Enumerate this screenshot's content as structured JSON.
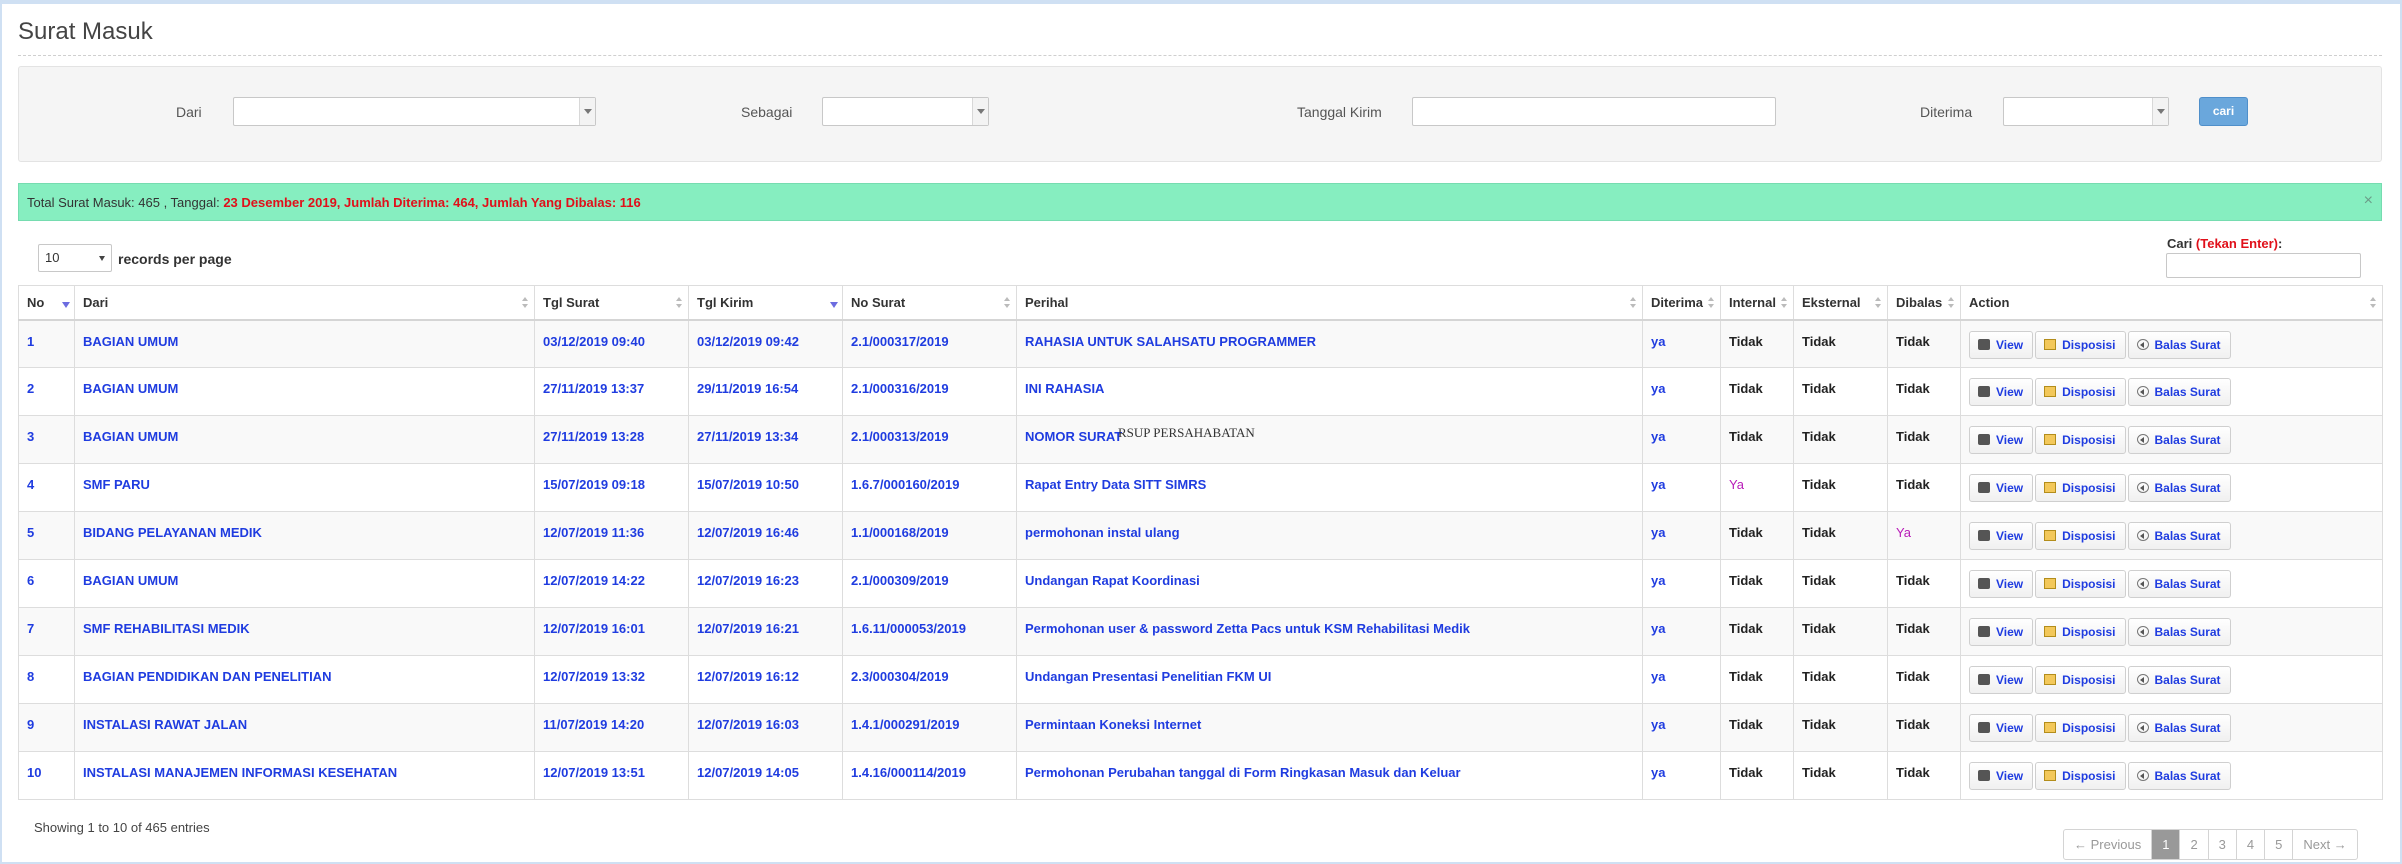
{
  "page": {
    "title": "Surat Masuk"
  },
  "filters": {
    "dari_label": "Dari",
    "dari_value": "",
    "sebagai_label": "Sebagai",
    "sebagai_value": "",
    "tanggal_label": "Tanggal Kirim",
    "tanggal_value": "",
    "diterima_label": "Diterima",
    "diterima_value": "",
    "cari_button": "cari"
  },
  "alert": {
    "prefix": "Total Surat Masuk: 465 , Tanggal: ",
    "highlight": "23 Desember 2019, Jumlah Diterima: 464, Jumlah Yang Dibalas: 116",
    "close": "×"
  },
  "length": {
    "value": "10",
    "label": "records per page"
  },
  "search": {
    "label": "Cari ",
    "hint": "(Tekan Enter)",
    "colon": ":",
    "value": ""
  },
  "columns": [
    "No",
    "Dari",
    "Tgl Surat",
    "Tgl Kirim",
    "No Surat",
    "Perihal",
    "Diterima",
    "Internal",
    "Eksternal",
    "Dibalas",
    "Action"
  ],
  "actions": {
    "view": "View",
    "disposisi": "Disposisi",
    "balas": "Balas Surat"
  },
  "rows": [
    {
      "no": "1",
      "dari": "BAGIAN UMUM",
      "tgl_surat": "03/12/2019 09:40",
      "tgl_kirim": "03/12/2019 09:42",
      "no_surat": "2.1/000317/2019",
      "perihal": "RAHASIA UNTUK SALAHSATU PROGRAMMER",
      "diterima": "ya",
      "internal": "Tidak",
      "eksternal": "Tidak",
      "dibalas": "Tidak"
    },
    {
      "no": "2",
      "dari": "BAGIAN UMUM",
      "tgl_surat": "27/11/2019 13:37",
      "tgl_kirim": "29/11/2019 16:54",
      "no_surat": "2.1/000316/2019",
      "perihal": "INI RAHASIA",
      "diterima": "ya",
      "internal": "Tidak",
      "eksternal": "Tidak",
      "dibalas": "Tidak"
    },
    {
      "no": "3",
      "dari": "BAGIAN UMUM",
      "tgl_surat": "27/11/2019 13:28",
      "tgl_kirim": "27/11/2019 13:34",
      "no_surat": "2.1/000313/2019",
      "perihal": "NOMOR SURAT",
      "diterima": "ya",
      "internal": "Tidak",
      "eksternal": "Tidak",
      "dibalas": "Tidak"
    },
    {
      "no": "4",
      "dari": "SMF PARU",
      "tgl_surat": "15/07/2019 09:18",
      "tgl_kirim": "15/07/2019 10:50",
      "no_surat": "1.6.7/000160/2019",
      "perihal": "Rapat Entry Data SITT SIMRS",
      "diterima": "ya",
      "internal": "Ya",
      "eksternal": "Tidak",
      "dibalas": "Tidak"
    },
    {
      "no": "5",
      "dari": "BIDANG PELAYANAN MEDIK",
      "tgl_surat": "12/07/2019 11:36",
      "tgl_kirim": "12/07/2019 16:46",
      "no_surat": "1.1/000168/2019",
      "perihal": "permohonan instal ulang",
      "diterima": "ya",
      "internal": "Tidak",
      "eksternal": "Tidak",
      "dibalas": "Ya"
    },
    {
      "no": "6",
      "dari": "BAGIAN UMUM",
      "tgl_surat": "12/07/2019 14:22",
      "tgl_kirim": "12/07/2019 16:23",
      "no_surat": "2.1/000309/2019",
      "perihal": "Undangan Rapat Koordinasi",
      "diterima": "ya",
      "internal": "Tidak",
      "eksternal": "Tidak",
      "dibalas": "Tidak"
    },
    {
      "no": "7",
      "dari": "SMF REHABILITASI MEDIK",
      "tgl_surat": "12/07/2019 16:01",
      "tgl_kirim": "12/07/2019 16:21",
      "no_surat": "1.6.11/000053/2019",
      "perihal": "Permohonan user & password Zetta Pacs untuk KSM Rehabilitasi Medik",
      "diterima": "ya",
      "internal": "Tidak",
      "eksternal": "Tidak",
      "dibalas": "Tidak"
    },
    {
      "no": "8",
      "dari": "BAGIAN PENDIDIKAN DAN PENELITIAN",
      "tgl_surat": "12/07/2019 13:32",
      "tgl_kirim": "12/07/2019 16:12",
      "no_surat": "2.3/000304/2019",
      "perihal": "Undangan Presentasi Penelitian FKM UI",
      "diterima": "ya",
      "internal": "Tidak",
      "eksternal": "Tidak",
      "dibalas": "Tidak"
    },
    {
      "no": "9",
      "dari": "INSTALASI RAWAT JALAN",
      "tgl_surat": "11/07/2019 14:20",
      "tgl_kirim": "12/07/2019 16:03",
      "no_surat": "1.4.1/000291/2019",
      "perihal": "Permintaan Koneksi Internet",
      "diterima": "ya",
      "internal": "Tidak",
      "eksternal": "Tidak",
      "dibalas": "Tidak"
    },
    {
      "no": "10",
      "dari": "INSTALASI MANAJEMEN INFORMASI KESEHATAN",
      "tgl_surat": "12/07/2019 13:51",
      "tgl_kirim": "12/07/2019 14:05",
      "no_surat": "1.4.16/000114/2019",
      "perihal": "Permohonan Perubahan tanggal di Form Ringkasan Masuk dan Keluar",
      "diterima": "ya",
      "internal": "Tidak",
      "eksternal": "Tidak",
      "dibalas": "Tidak"
    }
  ],
  "overlay": "RSUP PERSAHABATAN",
  "footer": {
    "info": "Showing 1 to 10 of 465 entries"
  },
  "pagination": {
    "previous": "← Previous",
    "pages": [
      "1",
      "2",
      "3",
      "4",
      "5"
    ],
    "next": "Next →",
    "active": "1"
  },
  "colors": {
    "link": "#1f3ce0",
    "alert_bg": "#86eec0",
    "alert_highlight": "#e0101a",
    "yes_magenta": "#b81cb8",
    "button_blue": "#6aa7dc"
  }
}
